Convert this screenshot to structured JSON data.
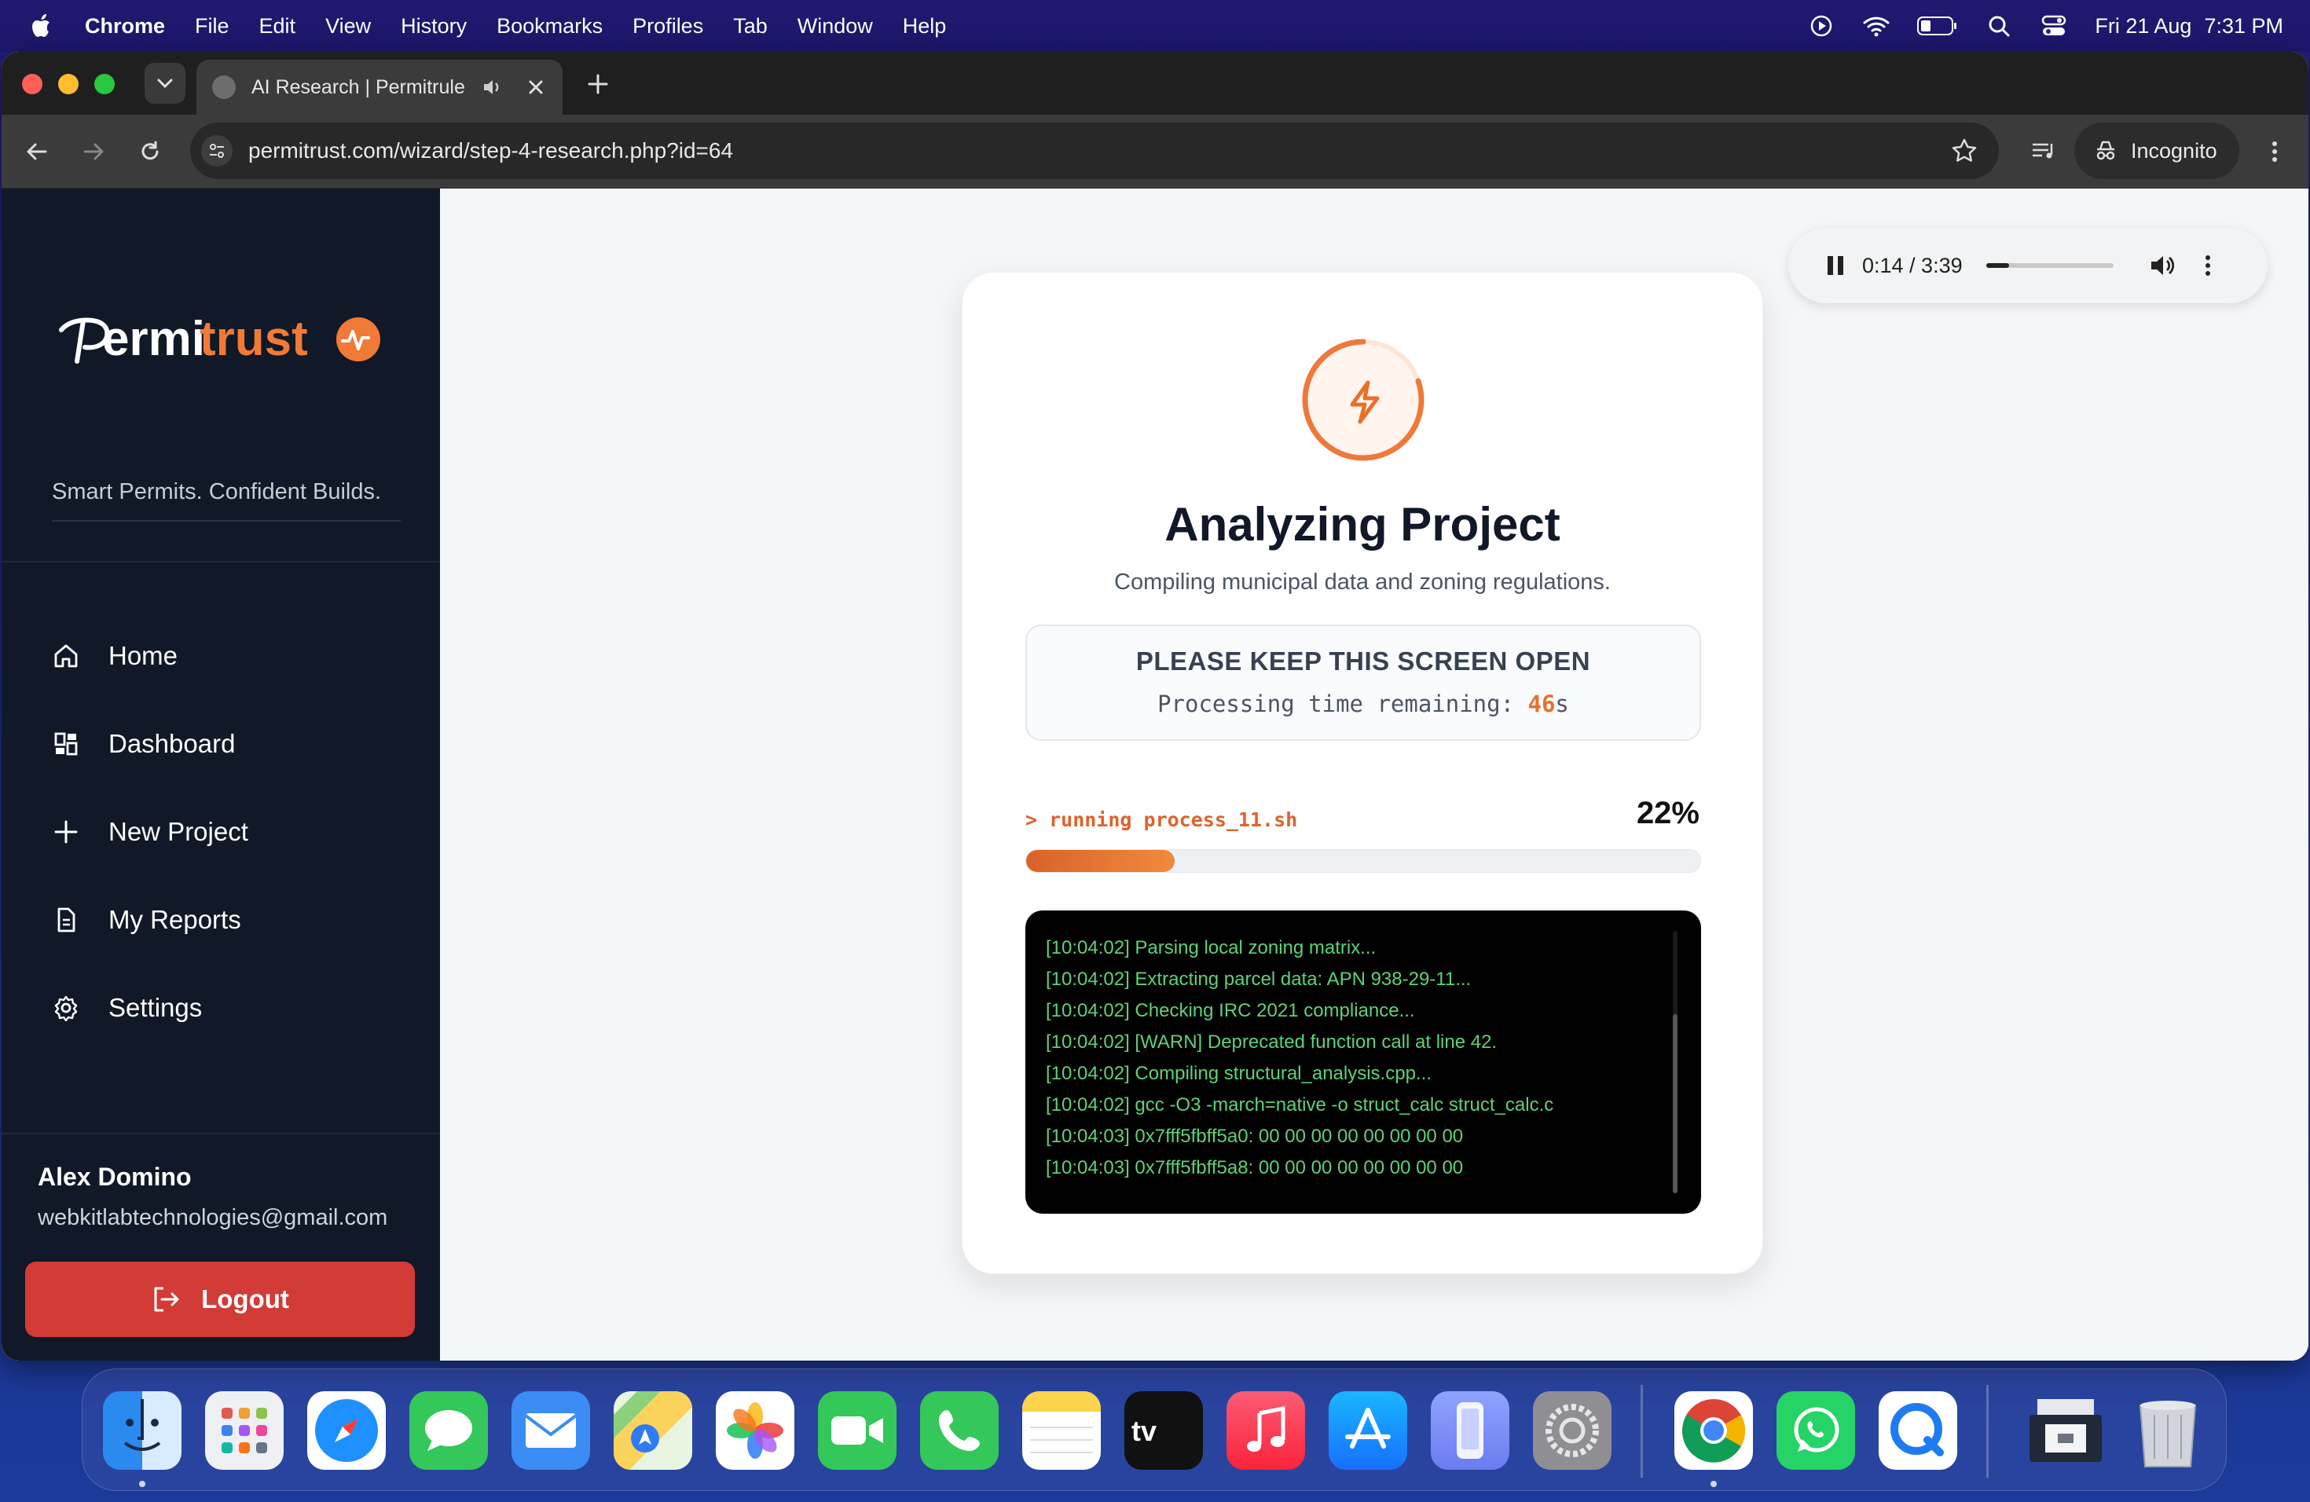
{
  "menubar": {
    "app_name": "Chrome",
    "items": [
      "File",
      "Edit",
      "View",
      "History",
      "Bookmarks",
      "Profiles",
      "Tab",
      "Window",
      "Help"
    ],
    "date": "Fri 21 Aug",
    "time": "7:31 PM"
  },
  "browser": {
    "tab_title": "AI Research | Permitrule",
    "url": "permitrust.com/wizard/step-4-research.php?id=64",
    "incognito_label": "Incognito"
  },
  "sidebar": {
    "brand": "Permitrust",
    "tagline": "Smart Permits. Confident Builds.",
    "nav": [
      {
        "label": "Home",
        "icon": "home-icon"
      },
      {
        "label": "Dashboard",
        "icon": "dashboard-icon"
      },
      {
        "label": "New Project",
        "icon": "plus-icon"
      },
      {
        "label": "My Reports",
        "icon": "document-icon"
      },
      {
        "label": "Settings",
        "icon": "gear-icon"
      }
    ],
    "user": {
      "name": "Alex Domino",
      "email": "webkitlabtechnologies@gmail.com"
    },
    "logout_label": "Logout"
  },
  "card": {
    "title": "Analyzing Project",
    "subtitle": "Compiling municipal data and zoning regulations.",
    "notice_title": "PLEASE KEEP THIS SCREEN OPEN",
    "timer_prefix": "Processing time remaining: ",
    "timer_value": "46",
    "timer_unit": "s",
    "process": "> running process_11.sh",
    "percent_label": "22%",
    "progress": 0.22,
    "log": [
      "[10:04:02] Parsing local zoning matrix...",
      "[10:04:02] Extracting parcel data: APN 938-29-11...",
      "[10:04:02] Checking IRC 2021 compliance...",
      "[10:04:02] [WARN] Deprecated function call at line 42.",
      "[10:04:02] Compiling structural_analysis.cpp...",
      "[10:04:02] gcc -O3 -march=native -o struct_calc struct_calc.c",
      "[10:04:03] 0x7fff5fbff5a0: 00 00 00 00 00 00 00 00",
      "[10:04:03] 0x7fff5fbff5a8: 00 00 00 00 00 00 00 00"
    ]
  },
  "audio": {
    "time": "0:14 / 3:39",
    "progress": 0.064
  },
  "colors": {
    "accent": "#e8702a",
    "sidebar": "#111827",
    "logout": "#d23b36",
    "log_text": "#5ed17a"
  },
  "dock": {
    "apps": [
      "Finder",
      "Launchpad",
      "Safari",
      "Messages",
      "Mail",
      "Maps",
      "Photos",
      "FaceTime",
      "Phone",
      "Notes",
      "TV",
      "Music",
      "App Store",
      "iPhone Mirroring",
      "System Settings",
      "Chrome",
      "WhatsApp",
      "QuickTime Player",
      "Downloads",
      "Trash"
    ]
  }
}
